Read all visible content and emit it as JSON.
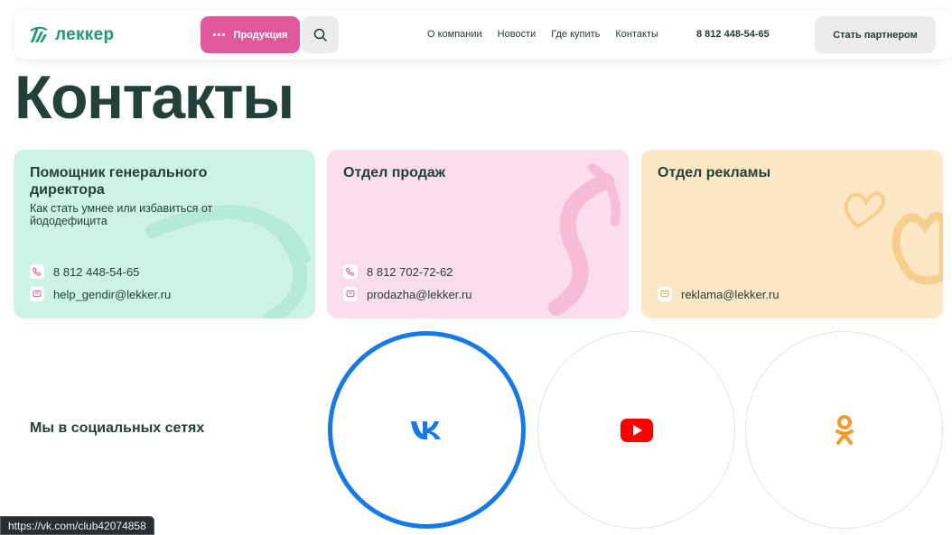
{
  "header": {
    "logo_text": "леккер",
    "products_label": "Продукция",
    "nav": [
      "О компании",
      "Новости",
      "Где купить",
      "Контакты"
    ],
    "phone": "8 812 448-54-65",
    "partner_label": "Стать партнером"
  },
  "page": {
    "title": "Контакты"
  },
  "cards": [
    {
      "title": "Помощник генерального директора",
      "subtitle": "Как стать умнее или избавиться от йододефицита",
      "phone": "8 812 448-54-65",
      "email": "help_gendir@lekker.ru"
    },
    {
      "title": "Отдел продаж",
      "phone": "8 812 702-72-62",
      "email": "prodazha@lekker.ru"
    },
    {
      "title": "Отдел рекламы",
      "email": "reklama@lekker.ru"
    }
  ],
  "social": {
    "title": "Мы в социальных сетях",
    "items": [
      {
        "name": "vk-icon",
        "color": "#1778e8"
      },
      {
        "name": "youtube-icon",
        "color": "#ff0000"
      },
      {
        "name": "odnoklassniki-icon",
        "color": "#f39a2a"
      }
    ]
  },
  "status_url": "https://vk.com/club42074858",
  "colors": {
    "brand_green": "#1f9a6f",
    "products_pink": "#e05a9b",
    "card_mint": "#cdf3e6",
    "card_pink": "#fbdded",
    "card_peach": "#fde7c5",
    "vk_blue": "#1778e8"
  }
}
